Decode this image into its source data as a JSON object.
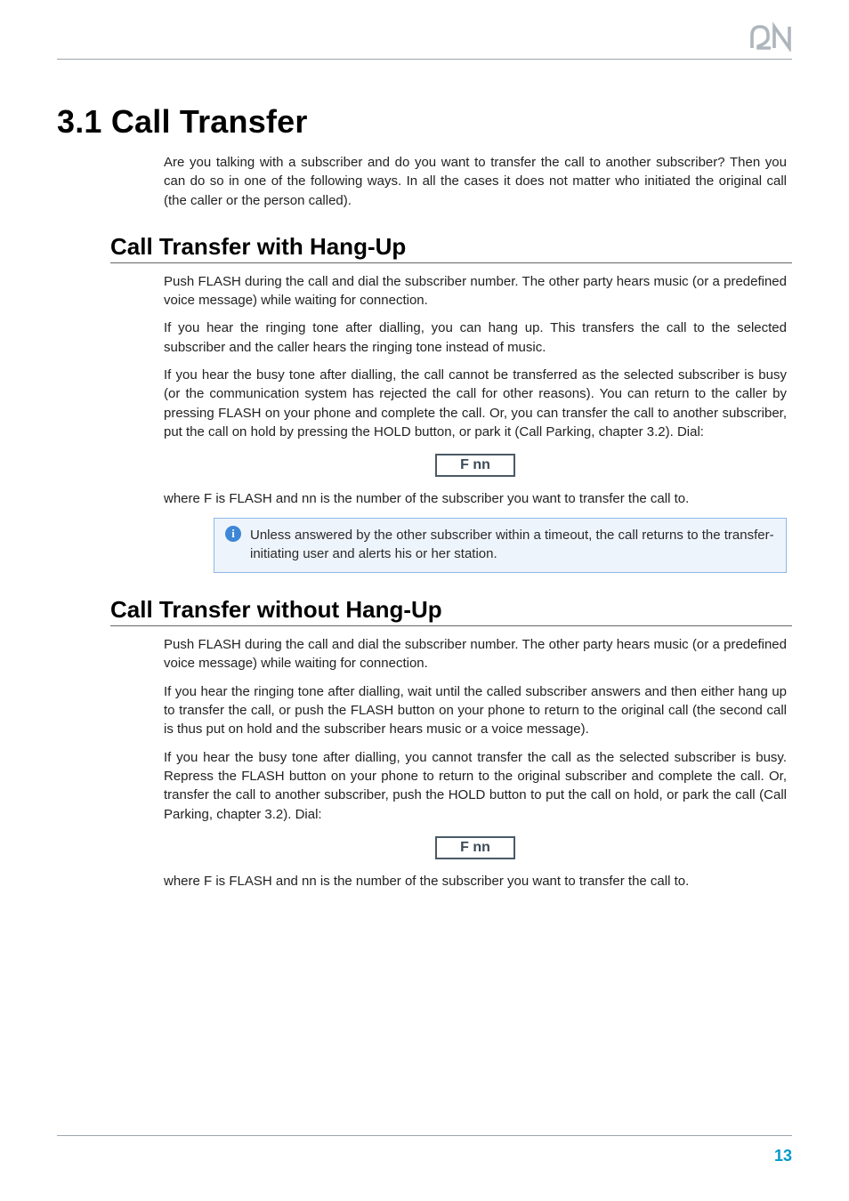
{
  "page": {
    "title": "3.1 Call Transfer",
    "intro": "Are you talking with a subscriber and do you want to transfer the call to another subscriber? Then you can do so in one of the following ways. In all the cases it does not matter who initiated the original call (the caller or the person called).",
    "page_number": "13"
  },
  "brand": {
    "logo_name": "2N"
  },
  "sections": {
    "with_hangup": {
      "heading": "Call Transfer with Hang-Up",
      "p1": "Push FLASH during the call and dial the subscriber number. The other party hears music (or a predefined voice message) while waiting for connection.",
      "p2": "If you hear the ringing tone after dialling, you can hang up. This transfers the call to the selected subscriber and the caller hears the ringing tone instead of music.",
      "p3": "If you hear the busy tone after dialling, the call cannot be transferred as the selected subscriber is busy (or the communication system has rejected the call for other reasons). You can return to the caller by pressing FLASH on your phone and complete the call. Or, you can transfer the call to another subscriber, put the call on hold by pressing the HOLD button, or park it (Call Parking, chapter 3.2). Dial:",
      "code": "F nn",
      "p4": "where F is FLASH and nn is the number of the subscriber you want to transfer the call to.",
      "note": "Unless answered by the other subscriber within a timeout, the call returns to the transfer-initiating user and alerts his or her station."
    },
    "without_hangup": {
      "heading": "Call Transfer without Hang-Up",
      "p1": "Push FLASH during the call and dial the subscriber number. The other party hears music (or a predefined voice message) while waiting for connection.",
      "p2": "If you hear the ringing tone after dialling, wait until the called subscriber answers and then either hang up to transfer the call, or push the FLASH button on your phone to return to the original call (the second call is thus put on hold and the subscriber hears music or a voice message).",
      "p3": "If you hear the busy tone after dialling, you cannot transfer the call as the selected subscriber is busy. Repress the FLASH button on your phone to return to the original subscriber and complete the call. Or, transfer the call to another subscriber, push the HOLD button to put the call on hold, or park the call (Call Parking, chapter 3.2). Dial:",
      "code": "F nn",
      "p4": "where F is FLASH and nn is the number of the subscriber you want to transfer the call to."
    }
  }
}
